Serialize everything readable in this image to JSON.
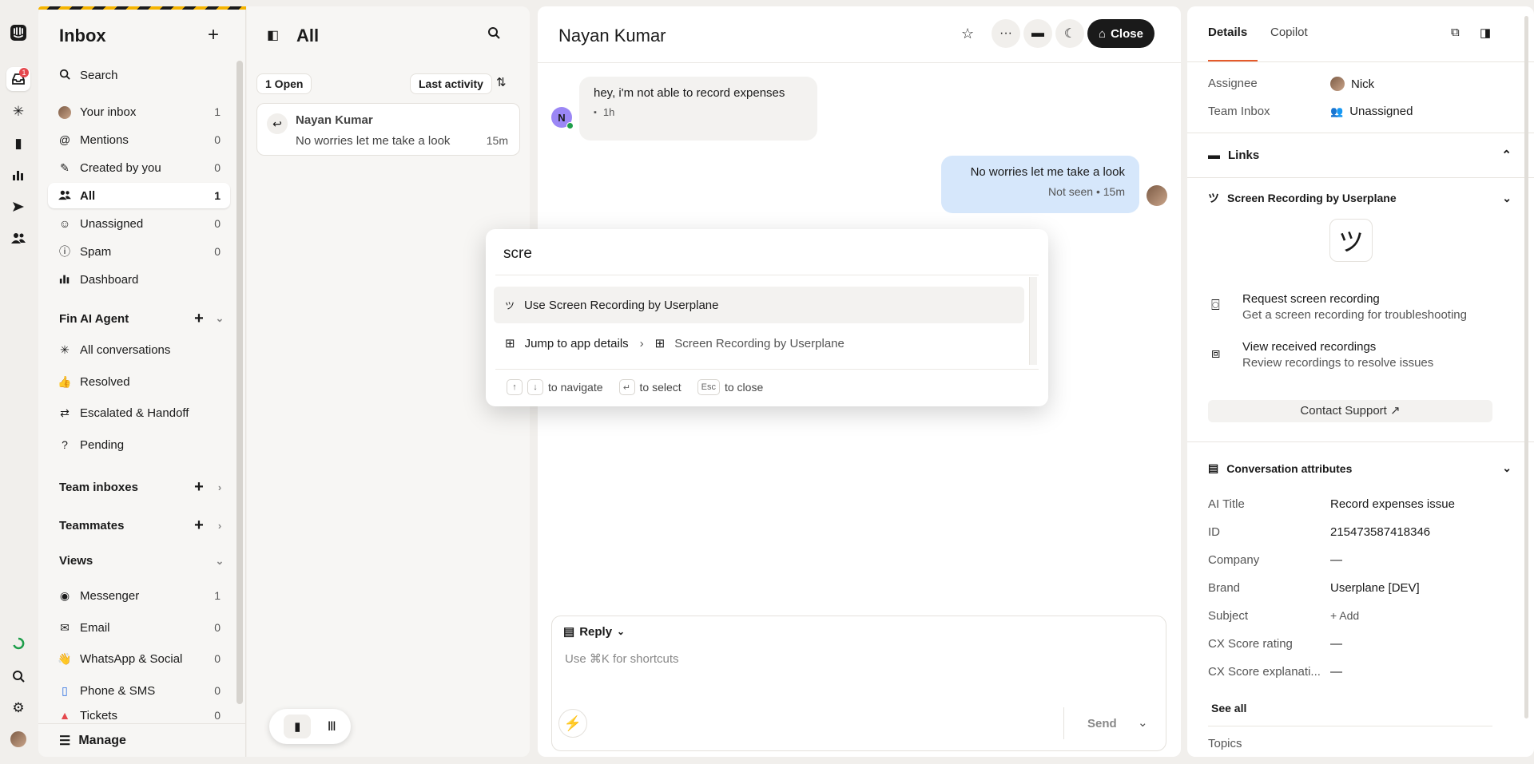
{
  "rail": {
    "inbox_badge": "1"
  },
  "nav": {
    "title": "Inbox",
    "search_label": "Search",
    "items": [
      {
        "label": "Your inbox",
        "count": "1"
      },
      {
        "label": "Mentions",
        "count": "0"
      },
      {
        "label": "Created by you",
        "count": "0"
      },
      {
        "label": "All",
        "count": "1"
      },
      {
        "label": "Unassigned",
        "count": "0"
      },
      {
        "label": "Spam",
        "count": "0"
      },
      {
        "label": "Dashboard",
        "count": ""
      }
    ],
    "fin_section": "Fin AI Agent",
    "fin_items": [
      "All conversations",
      "Resolved",
      "Escalated & Handoff",
      "Pending"
    ],
    "team_inboxes": "Team inboxes",
    "teammates": "Teammates",
    "views": "Views",
    "view_items": [
      {
        "label": "Messenger",
        "count": "1"
      },
      {
        "label": "Email",
        "count": "0"
      },
      {
        "label": "WhatsApp & Social",
        "count": "0"
      },
      {
        "label": "Phone & SMS",
        "count": "0"
      },
      {
        "label": "Tickets",
        "count": "0"
      }
    ],
    "manage": "Manage"
  },
  "list": {
    "title": "All",
    "open_count": "1 Open",
    "sort_label": "Last activity",
    "card": {
      "name": "Nayan Kumar",
      "preview": "No worries let me take a look",
      "time": "15m"
    }
  },
  "conversation": {
    "contact_name": "Nayan Kumar",
    "close_label": "Close",
    "avatar_initial": "N",
    "incoming_text": "hey, i'm not able to record expenses",
    "incoming_time": "1h",
    "outgoing_text": "No worries let me take a look",
    "outgoing_meta": "Not seen • 15m",
    "composer": {
      "mode": "Reply",
      "placeholder": "Use ⌘K for shortcuts",
      "send_label": "Send"
    }
  },
  "palette": {
    "query": "scre",
    "options": [
      {
        "label": "Use Screen Recording by Userplane",
        "extra": ""
      },
      {
        "label": "Jump to app details",
        "extra": "Screen Recording by Userplane"
      }
    ],
    "hints": {
      "navigate": "to navigate",
      "select": "to select",
      "esc_key": "Esc",
      "close": "to close"
    }
  },
  "details": {
    "tabs": [
      "Details",
      "Copilot"
    ],
    "assignee_label": "Assignee",
    "assignee_value": "Nick",
    "team_label": "Team Inbox",
    "team_value": "Unassigned",
    "links_title": "Links",
    "app_title": "Screen Recording by Userplane",
    "app_logo": "ツ",
    "actions": [
      {
        "title": "Request screen recording",
        "desc": "Get a screen recording for troubleshooting"
      },
      {
        "title": "View received recordings",
        "desc": "Review recordings to resolve issues"
      }
    ],
    "contact_support": "Contact Support ↗",
    "attrs_title": "Conversation attributes",
    "attrs": [
      {
        "k": "AI Title",
        "v": "Record expenses issue"
      },
      {
        "k": "ID",
        "v": "215473587418346"
      },
      {
        "k": "Company",
        "v": "—"
      },
      {
        "k": "Brand",
        "v": "Userplane [DEV]"
      },
      {
        "k": "Subject",
        "v": "+ Add"
      },
      {
        "k": "CX Score rating",
        "v": "—"
      },
      {
        "k": "CX Score explanati...",
        "v": "—"
      }
    ],
    "see_all": "See all",
    "topics": "Topics"
  },
  "colors": {
    "accent": "#1a1a1a",
    "bubble_out": "#d6e7fb",
    "badge": "#e5484d",
    "brand_stripe": "#f5b400"
  }
}
